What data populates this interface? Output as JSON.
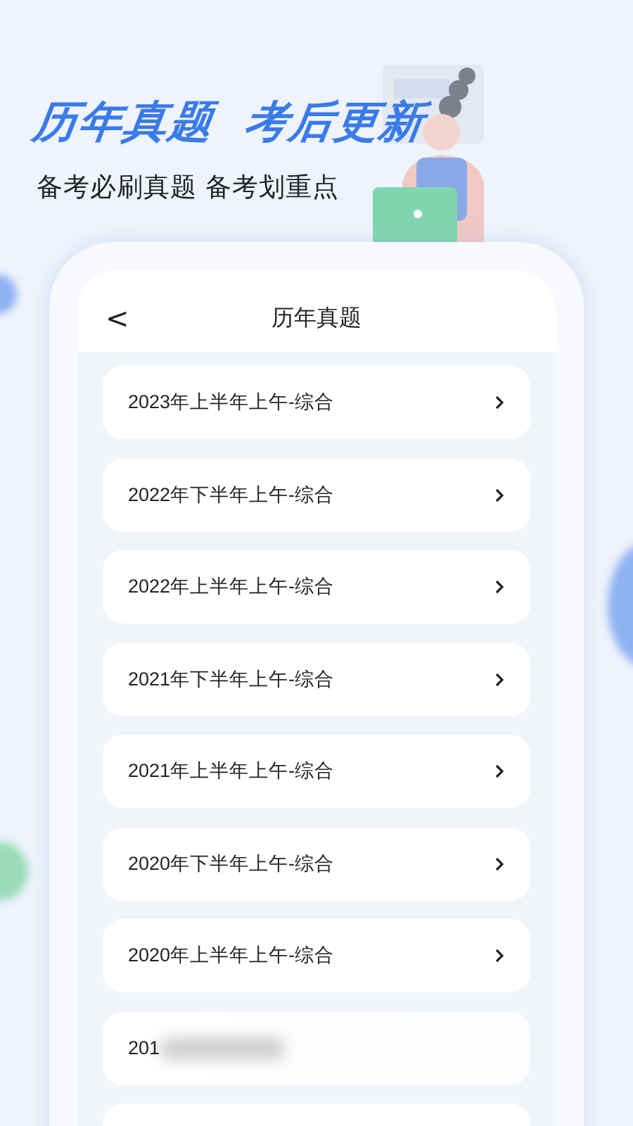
{
  "headline": {
    "left": "历年真题",
    "right": "考后更新"
  },
  "subtitle": "备考必刷真题 备考划重点",
  "nav": {
    "back": "<",
    "title": "历年真题"
  },
  "items": [
    {
      "label": "2023年上半年上午-综合",
      "kind": "row"
    },
    {
      "label": "2022年下半年上午-综合",
      "kind": "row"
    },
    {
      "label": "2022年上半年上午-综合",
      "kind": "row"
    },
    {
      "label": "2021年下半年上午-综合",
      "kind": "row"
    },
    {
      "label": "2021年上半年上午-综合",
      "kind": "row"
    },
    {
      "label": "2020年下半年上午-综合",
      "kind": "row"
    },
    {
      "label": "2020年上半年上午-综合",
      "kind": "row"
    },
    {
      "label": "201",
      "kind": "faded"
    }
  ]
}
